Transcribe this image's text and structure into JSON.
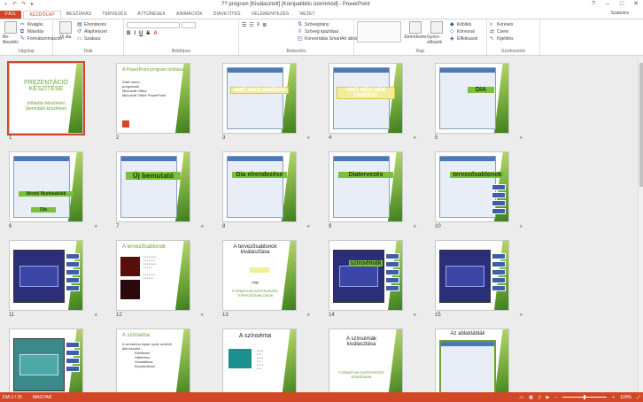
{
  "window": {
    "title": "?? program [Kiválasztott] [Kompatibilis üzemmód] - PowerPoint",
    "user": "Szabolcs",
    "quick_access": [
      "save-icon",
      "undo-icon",
      "redo-icon",
      "present-icon"
    ]
  },
  "tabs": [
    "FÁJL",
    "KEZDŐLAP",
    "BESZÚRÁS",
    "TERVEZÉS",
    "ÁTTŰNÉSEK",
    "ANIMÁCIÓK",
    "DIAVETÍTÉS",
    "VÉLEMÉNYEZÉS",
    "NÉZET"
  ],
  "active_tab": "KEZDŐLAP",
  "ribbon": {
    "clipboard": {
      "paste": "Be-illesztés",
      "cut": "Kivágás",
      "copy": "Másolás",
      "format_painter": "Formátummásoló",
      "label": "Vágólap"
    },
    "slides": {
      "new": "Új dia",
      "layout": "Elrendezés",
      "reset": "Alaphelyzet",
      "section": "Szakasz",
      "label": "Diák"
    },
    "font": {
      "label": "Betűtípus"
    },
    "paragraph": {
      "text_direction": "Szövegirány",
      "align_text": "Szöveg igazítása",
      "smartart": "Konvertálás SmartArt ábrává",
      "label": "Bekezdés"
    },
    "drawing": {
      "arrange": "Elrendezés",
      "quick_styles": "Gyors-stílusok",
      "fill": "Kitöltés",
      "outline": "Körvonal",
      "effects": "Effektusok",
      "label": "Rajz"
    },
    "editing": {
      "find": "Keresés",
      "replace": "Csere",
      "select": "Kijelölés",
      "label": "Szerkesztés"
    }
  },
  "slides": [
    {
      "num": "1",
      "title": "PREZENTÁCIÓ KÉSZÍTÉSE",
      "subtitle": "(előadás készítése) (bemutató készítése)"
    },
    {
      "num": "2",
      "title": "A PowerPoint program indítása",
      "lines": [
        "Start menü",
        "programok",
        "Microsoft Office",
        "Microsoft Office PowerPoint"
      ]
    },
    {
      "num": "3",
      "banner": "AMIT MÁR ISMERSZ"
    },
    {
      "num": "4",
      "banner": "AMIT MÉG NEM ISMERSZ"
    },
    {
      "num": "5",
      "banner": "DIA"
    },
    {
      "num": "6",
      "banner": "Nézet/ Munkaablak",
      "sub": "Dia"
    },
    {
      "num": "7",
      "banner": "Új bemutató"
    },
    {
      "num": "8",
      "banner": "Dia elrendezése"
    },
    {
      "num": "9",
      "banner": "Diatervezés"
    },
    {
      "num": "10",
      "banner": "tervezősablonok"
    },
    {
      "num": "11"
    },
    {
      "num": "12",
      "title": "A tervezősablonok"
    },
    {
      "num": "13",
      "title": "A tervezősablonok kiválasztása",
      "lines": [
        "vagy",
        "FORMÁTUM DIATERVEZÉS TERVEZŐSABLONOK"
      ]
    },
    {
      "num": "14",
      "banner": "színsémák"
    },
    {
      "num": "15"
    },
    {
      "num": "16"
    },
    {
      "num": "17",
      "title": "A színséma",
      "lines": [
        "A színséma olyan nyolc színből álló készlet...",
        "Kitöltések",
        "Háttérhez",
        "Vonalakhoz",
        "Árnyékokhoz"
      ]
    },
    {
      "num": "18",
      "title": "A színséma"
    },
    {
      "num": "19",
      "title": "A színsémák kiválasztása",
      "lines": [
        "FORMÁTUM DIATERVEZÉS SZÍNSÉMÁK"
      ]
    },
    {
      "num": "20",
      "title": "Az ablaktáblák"
    }
  ],
  "status": {
    "slide": "DIA 1 / 25",
    "lang": "MAGYAR",
    "zoom": "100%"
  },
  "colors": {
    "accent": "#d24726",
    "green": "#6aa333"
  }
}
